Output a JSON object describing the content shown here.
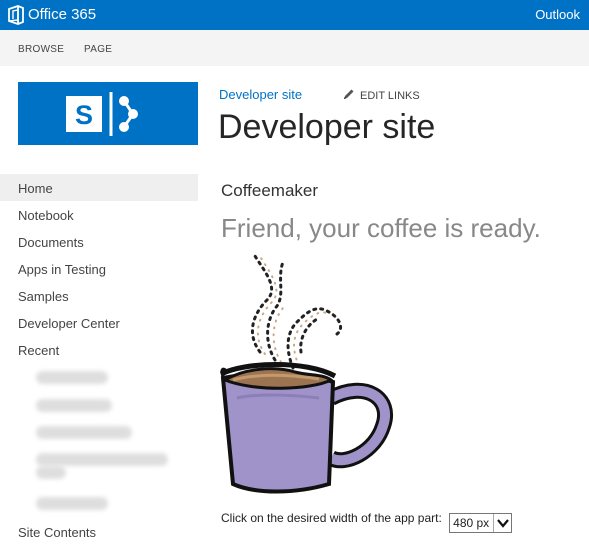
{
  "suite_bar": {
    "app_title": "Office 365",
    "right_link": "Outlook",
    "logo_icon": "office-logo-icon",
    "color": "#0072c6"
  },
  "ribbon": {
    "tabs": [
      "BROWSE",
      "PAGE"
    ]
  },
  "site": {
    "logo_icon": "sharepoint-logo-icon",
    "breadcrumb": "Developer site",
    "edit_links": "EDIT LINKS",
    "edit_icon": "pencil-icon",
    "title": "Developer site"
  },
  "quick_launch": {
    "items": [
      {
        "label": "Home",
        "selected": true
      },
      {
        "label": "Notebook"
      },
      {
        "label": "Documents"
      },
      {
        "label": "Apps in Testing"
      },
      {
        "label": "Samples"
      },
      {
        "label": "Developer Center"
      },
      {
        "label": "Recent"
      }
    ],
    "footer_item": "Site Contents"
  },
  "app_part": {
    "title": "Coffeemaker",
    "message": "Friend, your coffee is ready.",
    "image_icon": "coffee-mug-icon",
    "width_prompt": "Click on the desired width of the app part:",
    "width_selected": "480 px"
  }
}
